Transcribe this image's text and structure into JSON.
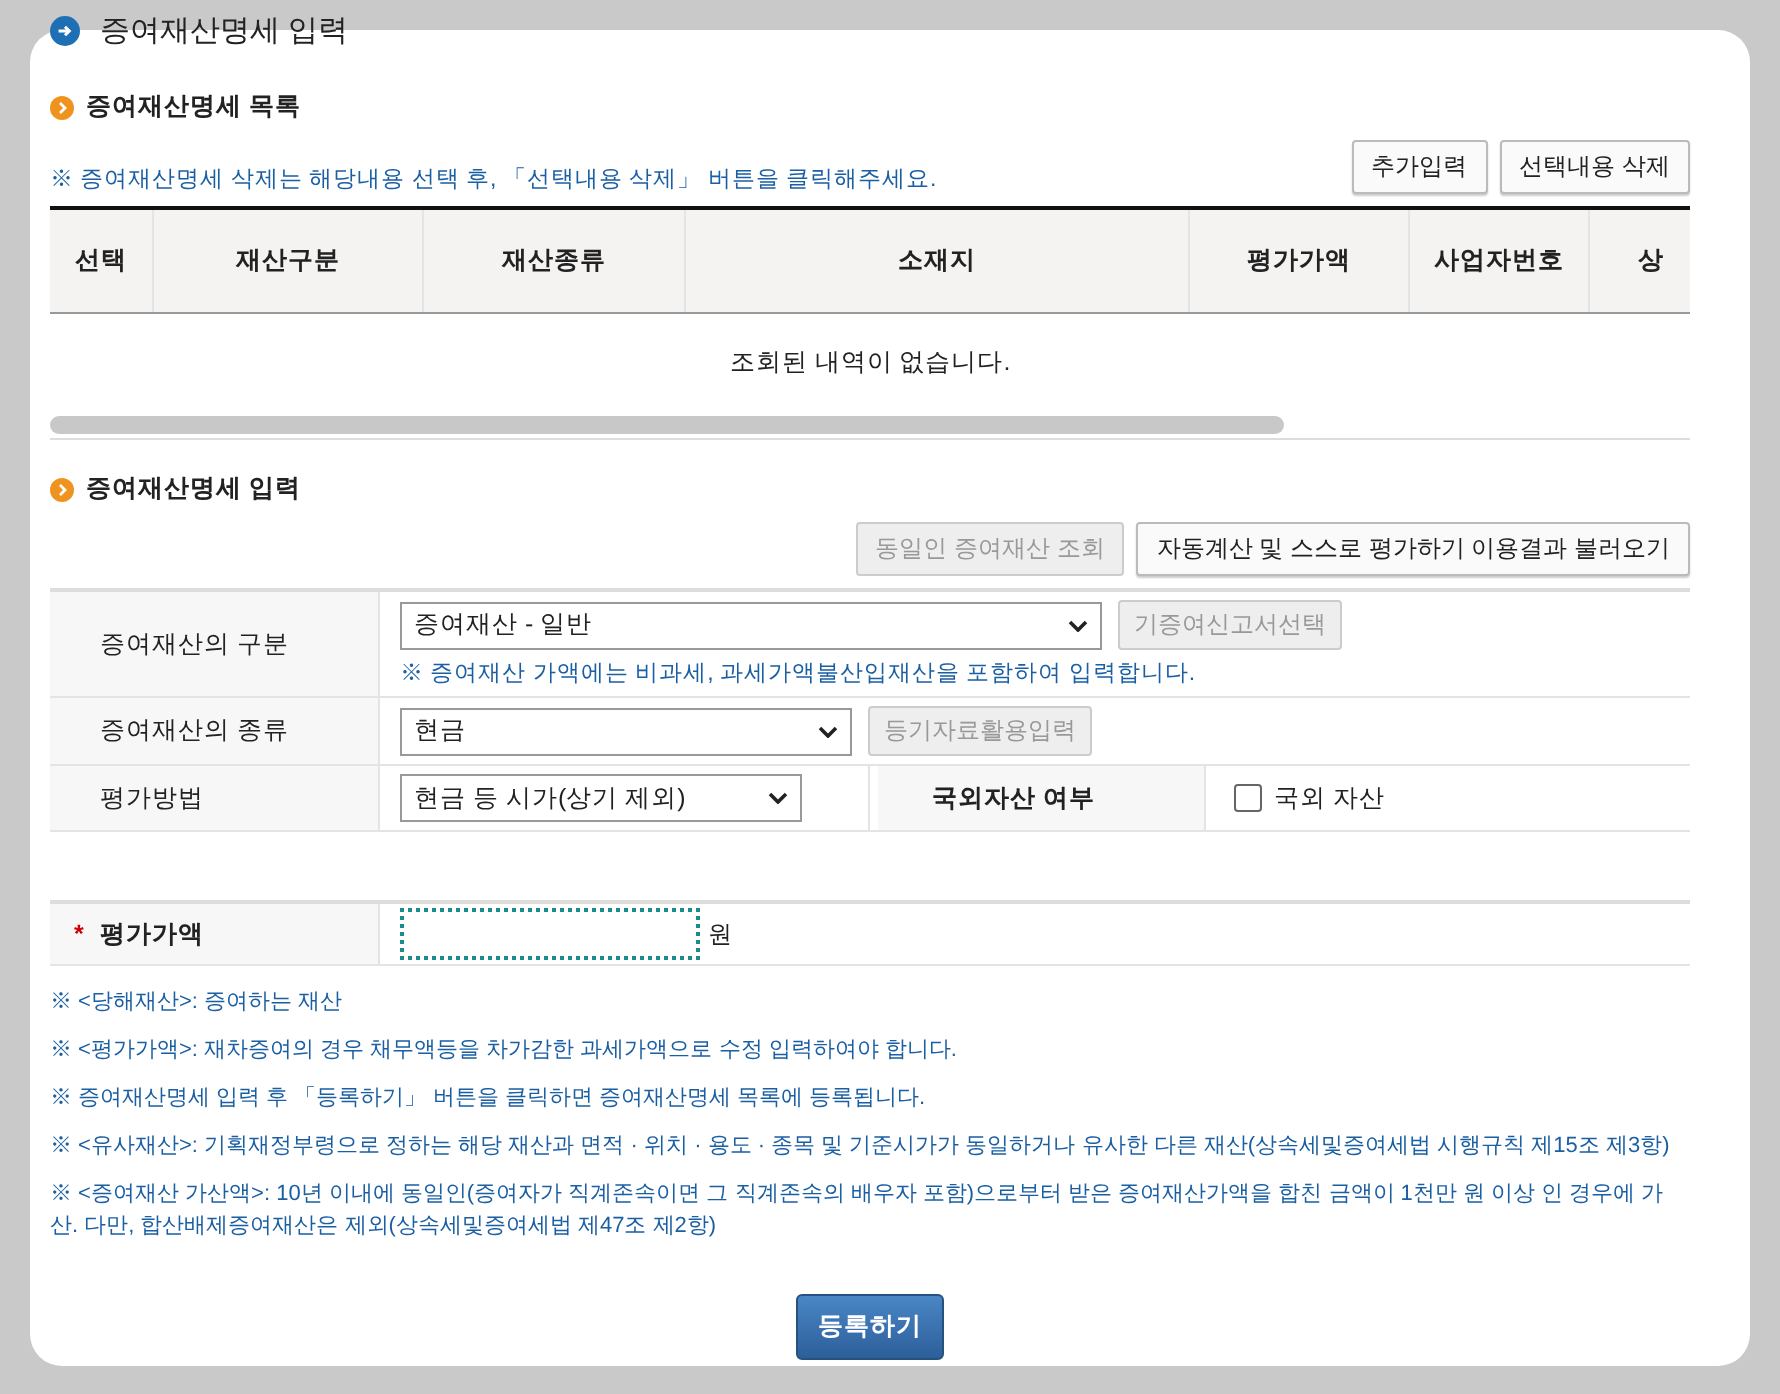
{
  "page_title": "증여재산명세 입력",
  "list_section": {
    "title": "증여재산명세 목록",
    "note": "※ 증여재산명세 삭제는 해당내용 선택 후, 「선택내용 삭제」 버튼을 클릭해주세요.",
    "buttons": [
      {
        "label": "추가입력",
        "disabled": false
      },
      {
        "label": "선택내용 삭제",
        "disabled": false
      }
    ],
    "table": {
      "columns": [
        "선택",
        "재산구분",
        "재산종류",
        "소재지",
        "평가가액",
        "사업자번호",
        "상"
      ],
      "empty_message": "조회된 내역이 없습니다."
    }
  },
  "input_section": {
    "title": "증여재산명세 입력",
    "buttons": [
      {
        "label": "동일인 증여재산 조회",
        "disabled": true
      },
      {
        "label": "자동계산 및 스스로 평가하기 이용결과 불러오기",
        "disabled": false
      }
    ],
    "rows": [
      {
        "kind": "select",
        "label": "증여재산의 구분",
        "value": "증여재산 - 일반",
        "button": {
          "label": "기증여신고서선택",
          "disabled": true
        },
        "note": "※ 증여재산 가액에는 비과세, 과세가액불산입재산을 포함하여 입력합니다."
      },
      {
        "kind": "select",
        "label": "증여재산의 종류",
        "value": "현금",
        "button": {
          "label": "등기자료활용입력",
          "disabled": true
        }
      },
      {
        "kind": "select_check",
        "label": "평가방법",
        "value": "현금 등 시가(상기 제외)",
        "label_2": "국외자산 여부",
        "checkbox": {
          "label": "국외 자산",
          "checked": false
        }
      }
    ]
  },
  "amount": {
    "label": "평가가액",
    "required": true,
    "required_mark": "*",
    "focused": true,
    "unit": "원"
  },
  "notes": [
    "※ <당해재산>: 증여하는 재산",
    "※ <평가가액>: 재차증여의 경우 채무액등을 차가감한 과세가액으로 수정 입력하여야 합니다.",
    "※ 증여재산명세 입력 후 「등록하기」 버튼을 클릭하면 증여재산명세 목록에 등록됩니다.",
    "※ <유사재산>: 기획재정부령으로 정하는 해당 재산과 면적 · 위치 · 용도 · 종목 및 기준시가가 동일하거나 유사한 다른 재산(상속세및증여세법 시행규칙 제15조 제3항)",
    "※ <증여재산 가산액>: 10년 이내에 동일인(증여자가 직계존속이면 그 직계존속의 배우자 포함)으로부터 받은 증여재산가액을 합친 금액이 1천만 원 이상 인 경우에 가산. 다만, 합산배제증여재산은 제외(상속세및증여세법 제47조 제2항)"
  ],
  "submit_button": "등록하기"
}
